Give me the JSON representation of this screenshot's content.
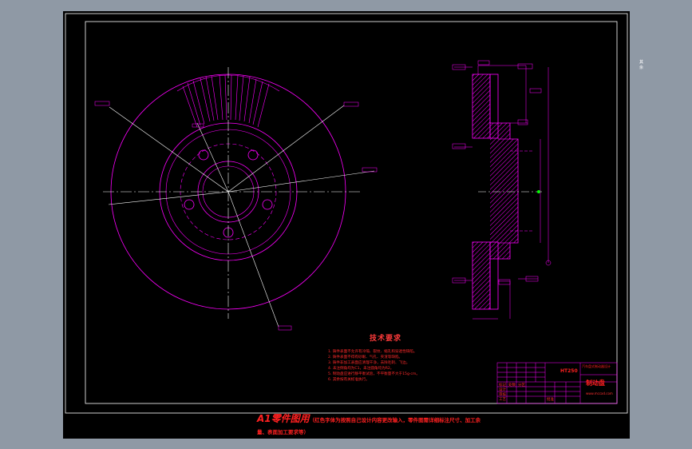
{
  "technical_requirements": {
    "title": "技术要求",
    "items": [
      "1. 铸件表面不允许有冷隔、裂纹、缩孔和穿透性缺陷。",
      "2. 铸件表面不得有砂眼、气孔、夹渣等缺陷。",
      "3. 铸件非加工表面应清理干净，去除毛刺、飞边。",
      "4. 未注倒角均为C1，未注圆角均为R2。",
      "5. 制动盘应进行静平衡试验，不平衡量不大于15g·cm。",
      "6. 其余按有关标准执行。"
    ]
  },
  "title_block": {
    "material": "HT250",
    "drawing_no": "汽车盘式制动器设计",
    "part_name": "制动盘",
    "site": "www.mccad.com",
    "row_labels": [
      "标记",
      "处数",
      "分区",
      "设计",
      "审核",
      "工艺",
      "批准"
    ]
  },
  "footer": {
    "main": "A1零件图用",
    "note": "（红色字体为按照自己设计内容更改输入，零件图需详细标注尺寸、加工余",
    "note2": "量、表面加工要求等）"
  },
  "surface_note": "其余"
}
